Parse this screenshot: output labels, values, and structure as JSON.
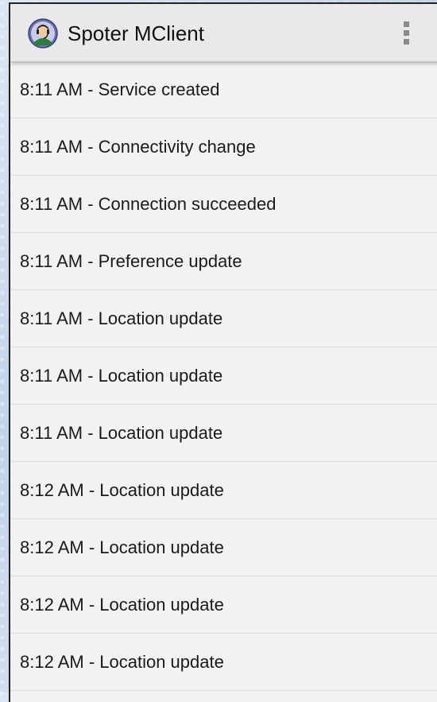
{
  "action_bar": {
    "title": "Spoter MClient",
    "icon": "app-agent-icon",
    "menu_icon": "overflow-menu-icon"
  },
  "log": [
    {
      "time": "8:11 AM",
      "event": "Service created",
      "text": "8:11 AM - Service created"
    },
    {
      "time": "8:11 AM",
      "event": "Connectivity change",
      "text": "8:11 AM - Connectivity change"
    },
    {
      "time": "8:11 AM",
      "event": "Connection succeeded",
      "text": "8:11 AM - Connection succeeded"
    },
    {
      "time": "8:11 AM",
      "event": "Preference update",
      "text": "8:11 AM - Preference update"
    },
    {
      "time": "8:11 AM",
      "event": "Location update",
      "text": "8:11 AM - Location update"
    },
    {
      "time": "8:11 AM",
      "event": "Location update",
      "text": "8:11 AM - Location update"
    },
    {
      "time": "8:11 AM",
      "event": "Location update",
      "text": "8:11 AM - Location update"
    },
    {
      "time": "8:12 AM",
      "event": "Location update",
      "text": "8:12 AM - Location update"
    },
    {
      "time": "8:12 AM",
      "event": "Location update",
      "text": "8:12 AM - Location update"
    },
    {
      "time": "8:12 AM",
      "event": "Location update",
      "text": "8:12 AM - Location update"
    },
    {
      "time": "8:12 AM",
      "event": "Location update",
      "text": "8:12 AM - Location update"
    }
  ],
  "colors": {
    "action_bar_bg": "#e9e9e9",
    "list_bg": "#f2f2f2",
    "divider": "#d8d8d8",
    "text": "#1a1a1a"
  }
}
